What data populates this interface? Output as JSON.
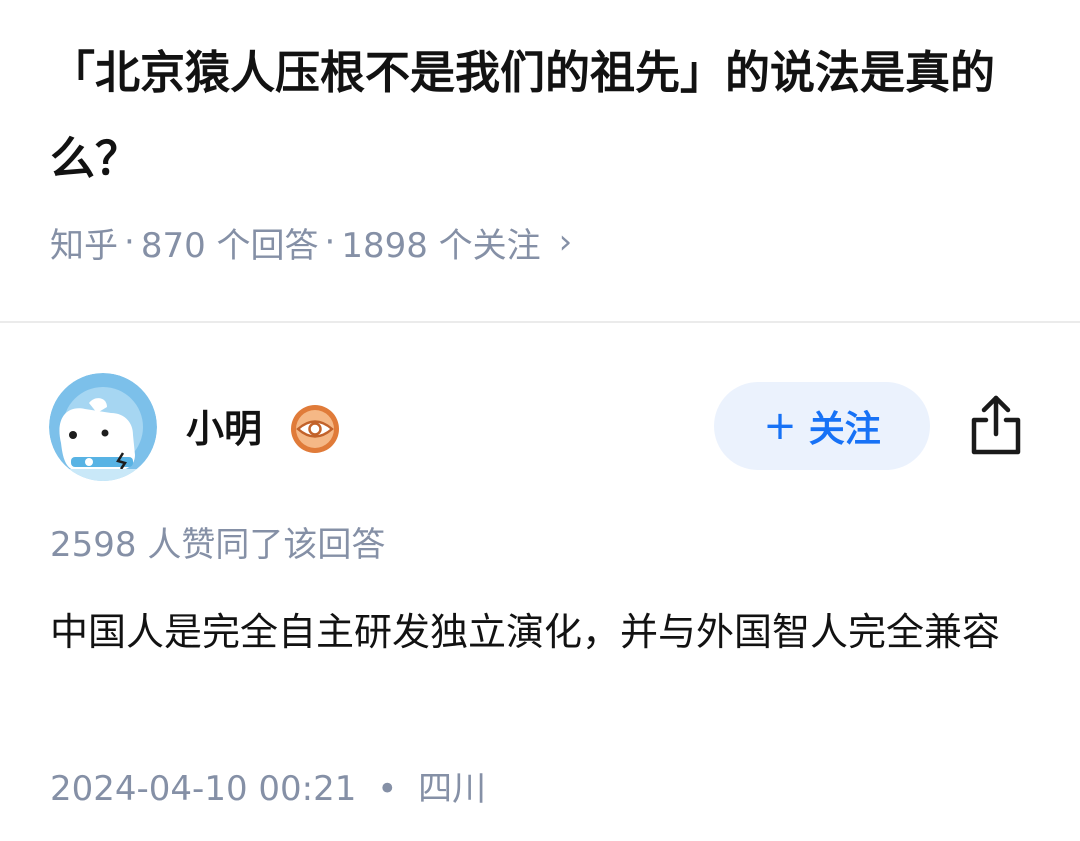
{
  "question": {
    "title": "「北京猿人压根不是我们的祖先」的说法是真的么？",
    "meta": {
      "source": "知乎",
      "answers": "870 个回答",
      "followers": "1898 个关注",
      "separator": "·",
      "chevron": "›"
    }
  },
  "author": {
    "name": "小明",
    "avatar_icon": "cartoon-dog-avatar",
    "badge_icon": "eye-badge-icon"
  },
  "actions": {
    "follow_plus": "+",
    "follow_label": "关注",
    "share_icon": "share-icon"
  },
  "answer": {
    "votes": "2598 人赞同了该回答",
    "content": "中国人是完全自主研发独立演化，并与外国智人完全兼容",
    "date": "2024-04-10 00:21",
    "dot": "•",
    "location": "四川"
  },
  "colors": {
    "accent": "#1772f6",
    "follow_bg": "#ebf2fd",
    "meta_text": "#8590a6",
    "badge": "#e07b39"
  }
}
